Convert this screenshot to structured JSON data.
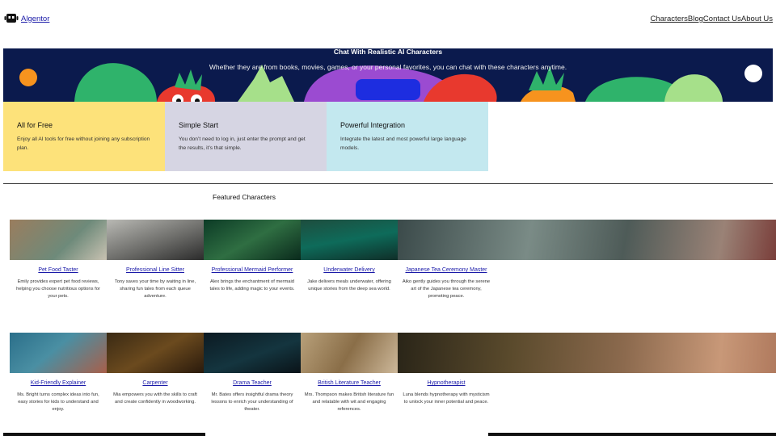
{
  "header": {
    "brand": "Algentor",
    "nav": [
      "Characters",
      "Blog",
      "Contact Us",
      "About Us"
    ]
  },
  "hero": {
    "title": "Chat With Realistic AI Characters",
    "subtitle": "Whether they are from books, movies, games, or your personal favorites, you can chat with these characters anytime."
  },
  "features": [
    {
      "title": "All for Free",
      "text": "Enjoy all AI tools for free without joining any subscription plan.",
      "color": "#fde27a"
    },
    {
      "title": "Simple Start",
      "text": "You don’t need to log in, just enter the prompt and get the results, it’s that simple.",
      "color": "#d6d5e3"
    },
    {
      "title": "Powerful Integration",
      "text": "Integrate the latest and most powerful large language models.",
      "color": "#c3e8ef"
    }
  ],
  "featured_title": "Featured Characters",
  "characters_row1": [
    {
      "title": "Pet Food Taster",
      "desc": "Emily provides expert pet food reviews, helping you choose nutritious options for your pets."
    },
    {
      "title": "Professional Line Sitter",
      "desc": "Tony saves your time by waiting in line, sharing fun tales from each queue adventure."
    },
    {
      "title": "Professional Mermaid Performer",
      "desc": "Alex brings the enchantment of mermaid tales to life, adding magic to your events."
    },
    {
      "title": "Underwater Delivery",
      "desc": "Jake delivers meals underwater, offering unique stories from the deep sea world."
    },
    {
      "title": "Japanese Tea Ceremony Master",
      "desc": "Aiko gently guides you through the serene art of the Japanese tea ceremony, promoting peace."
    }
  ],
  "characters_row2": [
    {
      "title": "Kid-Friendly Explainer",
      "desc": "Ms. Bright turns complex ideas into fun, easy stories for kids to understand and enjoy."
    },
    {
      "title": "Carpenter",
      "desc": "Mia empowers you with the skills to craft and create confidently in woodworking."
    },
    {
      "title": "Drama Teacher",
      "desc": "Mr. Bates offers insightful drama theory lessons to enrich your understanding of theater."
    },
    {
      "title": "British Literature Teacher",
      "desc": "Mrs. Thompson makes British literature fun and relatable with wit and engaging references."
    },
    {
      "title": "Hypnotherapist",
      "desc": "Luna blends hypnotherapy with mysticism to unlock your inner potential and peace."
    }
  ]
}
